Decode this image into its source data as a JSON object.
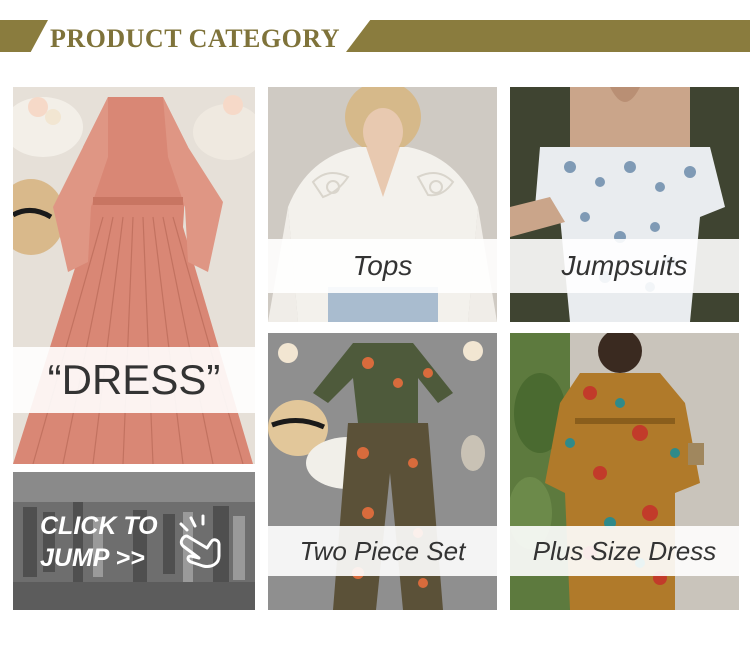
{
  "banner": {
    "title": "PRODUCT CATEGORY"
  },
  "categories": {
    "dress": "“DRESS”",
    "tops": "Tops",
    "jumpsuits": "Jumpsuits",
    "two_piece": "Two Piece Set",
    "plus_size": "Plus Size Dress"
  },
  "cta": {
    "line1": "CLICK TO",
    "line2": "JUMP >>"
  },
  "colors": {
    "accent": "#8a7c3e",
    "dress_pink": "#d98775",
    "floral_brown": "#b07a2a"
  }
}
